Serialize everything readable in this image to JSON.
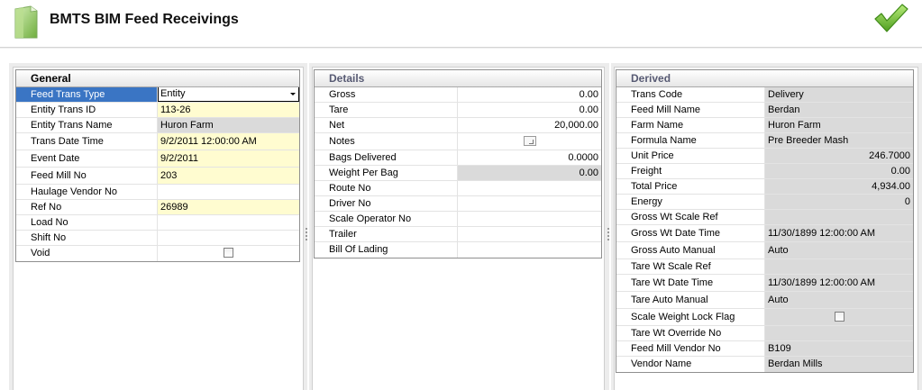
{
  "header": {
    "title": "BMTS BIM Feed Receivings",
    "doc_icon": "document-icon",
    "ok_icon": "checkmark-icon",
    "accent": "#72c23a"
  },
  "general": {
    "title": "General",
    "rows": [
      {
        "label": "Feed Trans Type",
        "value": "Entity"
      },
      {
        "label": "Entity Trans ID",
        "value": "113-26"
      },
      {
        "label": "Entity Trans Name",
        "value": "Huron Farm"
      },
      {
        "label": "Trans Date Time",
        "value": "9/2/2011 12:00:00 AM"
      },
      {
        "label": "Event Date",
        "value": "9/2/2011"
      },
      {
        "label": "Feed Mill No",
        "value": "203"
      },
      {
        "label": "Haulage Vendor No",
        "value": ""
      },
      {
        "label": "Ref No",
        "value": "26989"
      },
      {
        "label": "Load No",
        "value": ""
      },
      {
        "label": "Shift No",
        "value": ""
      },
      {
        "label": "Void",
        "value": ""
      }
    ]
  },
  "details": {
    "title": "Details",
    "rows": [
      {
        "label": "Gross",
        "value": "0.00"
      },
      {
        "label": "Tare",
        "value": "0.00"
      },
      {
        "label": "Net",
        "value": "20,000.00"
      },
      {
        "label": "Notes",
        "value": ""
      },
      {
        "label": "Bags Delivered",
        "value": "0.0000"
      },
      {
        "label": "Weight Per Bag",
        "value": "0.00"
      },
      {
        "label": "Route No",
        "value": ""
      },
      {
        "label": "Driver No",
        "value": ""
      },
      {
        "label": "Scale Operator No",
        "value": ""
      },
      {
        "label": "Trailer",
        "value": ""
      },
      {
        "label": "Bill Of Lading",
        "value": ""
      }
    ]
  },
  "derived": {
    "title": "Derived",
    "rows": [
      {
        "label": "Trans Code",
        "value": "Delivery"
      },
      {
        "label": "Feed Mill Name",
        "value": "Berdan"
      },
      {
        "label": "Farm Name",
        "value": "Huron Farm"
      },
      {
        "label": "Formula Name",
        "value": "Pre Breeder Mash"
      },
      {
        "label": "Unit Price",
        "value": "246.7000"
      },
      {
        "label": "Freight",
        "value": "0.00"
      },
      {
        "label": "Total Price",
        "value": "4,934.00"
      },
      {
        "label": "Energy",
        "value": "0"
      },
      {
        "label": "Gross Wt Scale Ref",
        "value": ""
      },
      {
        "label": "Gross Wt Date Time",
        "value": "11/30/1899 12:00:00 AM"
      },
      {
        "label": "Gross Auto Manual",
        "value": "Auto"
      },
      {
        "label": "Tare Wt Scale Ref",
        "value": ""
      },
      {
        "label": "Tare Wt Date Time",
        "value": "11/30/1899 12:00:00 AM"
      },
      {
        "label": "Tare Auto Manual",
        "value": "Auto"
      },
      {
        "label": "Scale Weight Lock Flag",
        "value": ""
      },
      {
        "label": "Tare Wt Override No",
        "value": ""
      },
      {
        "label": "Feed Mill Vendor No",
        "value": "B109"
      },
      {
        "label": "Vendor Name",
        "value": "Berdan Mills"
      }
    ]
  }
}
